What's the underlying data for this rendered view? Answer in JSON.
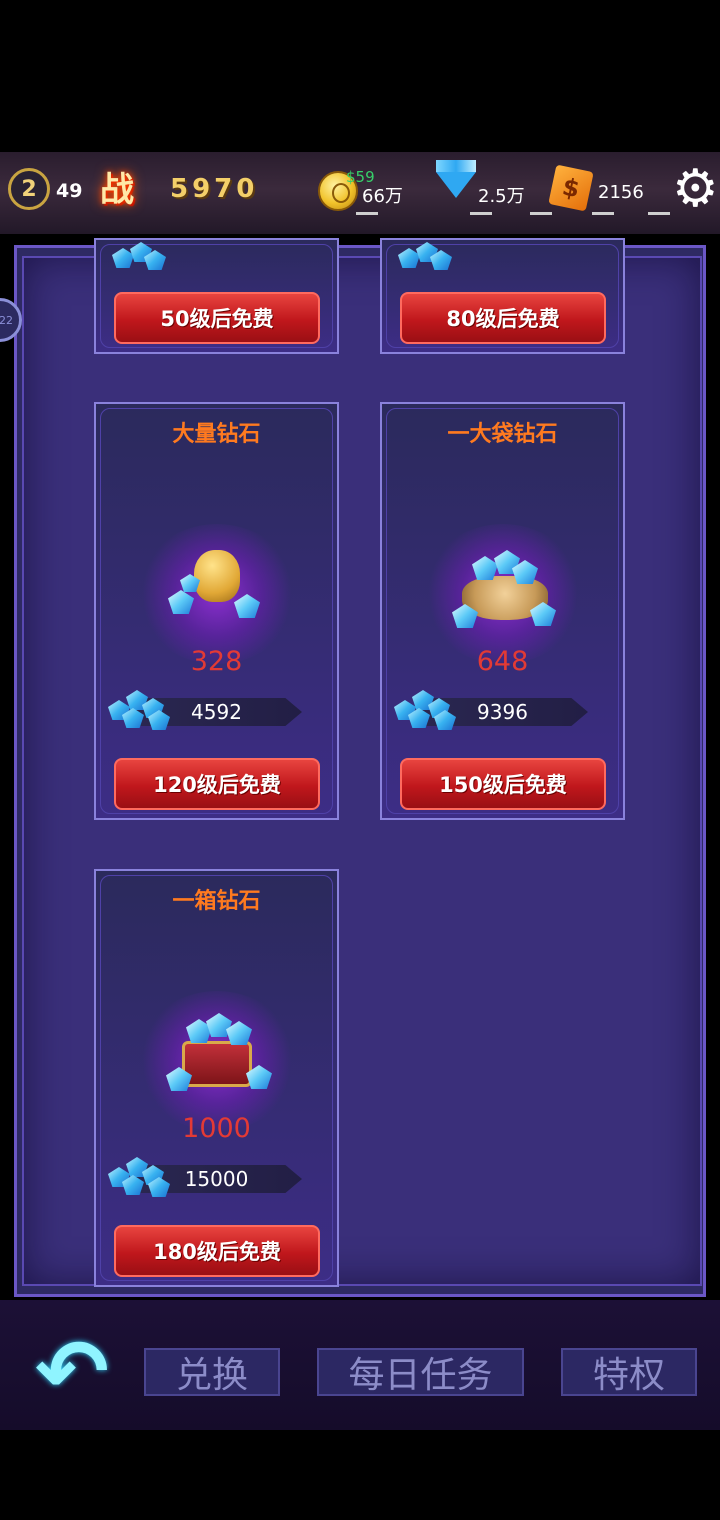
{
  "header": {
    "level": "2",
    "level_value": "49",
    "battle_icon_label": "战",
    "power": "5970",
    "coin_price": "$59",
    "coins": "66万",
    "diamonds": "2.5万",
    "cash_symbol": "$",
    "cash": "2156"
  },
  "side_bubble": "22",
  "cards": [
    {
      "button": "50级后免费"
    },
    {
      "button": "80级后免费"
    },
    {
      "title": "大量钻石",
      "price": "328",
      "amount": "4592",
      "button": "120级后免费"
    },
    {
      "title": "一大袋钻石",
      "price": "648",
      "amount": "9396",
      "button": "150级后免费"
    },
    {
      "title": "一箱钻石",
      "price": "1000",
      "amount": "15000",
      "button": "180级后免费"
    }
  ],
  "nav": {
    "tab_exchange": "兑换",
    "tab_daily": "每日任务",
    "tab_privilege": "特权"
  },
  "colors": {
    "title_orange": "#ff7a1f",
    "price_red": "#e33a35",
    "button_red": "#c0171c",
    "panel_purple": "#3a2f7a"
  }
}
